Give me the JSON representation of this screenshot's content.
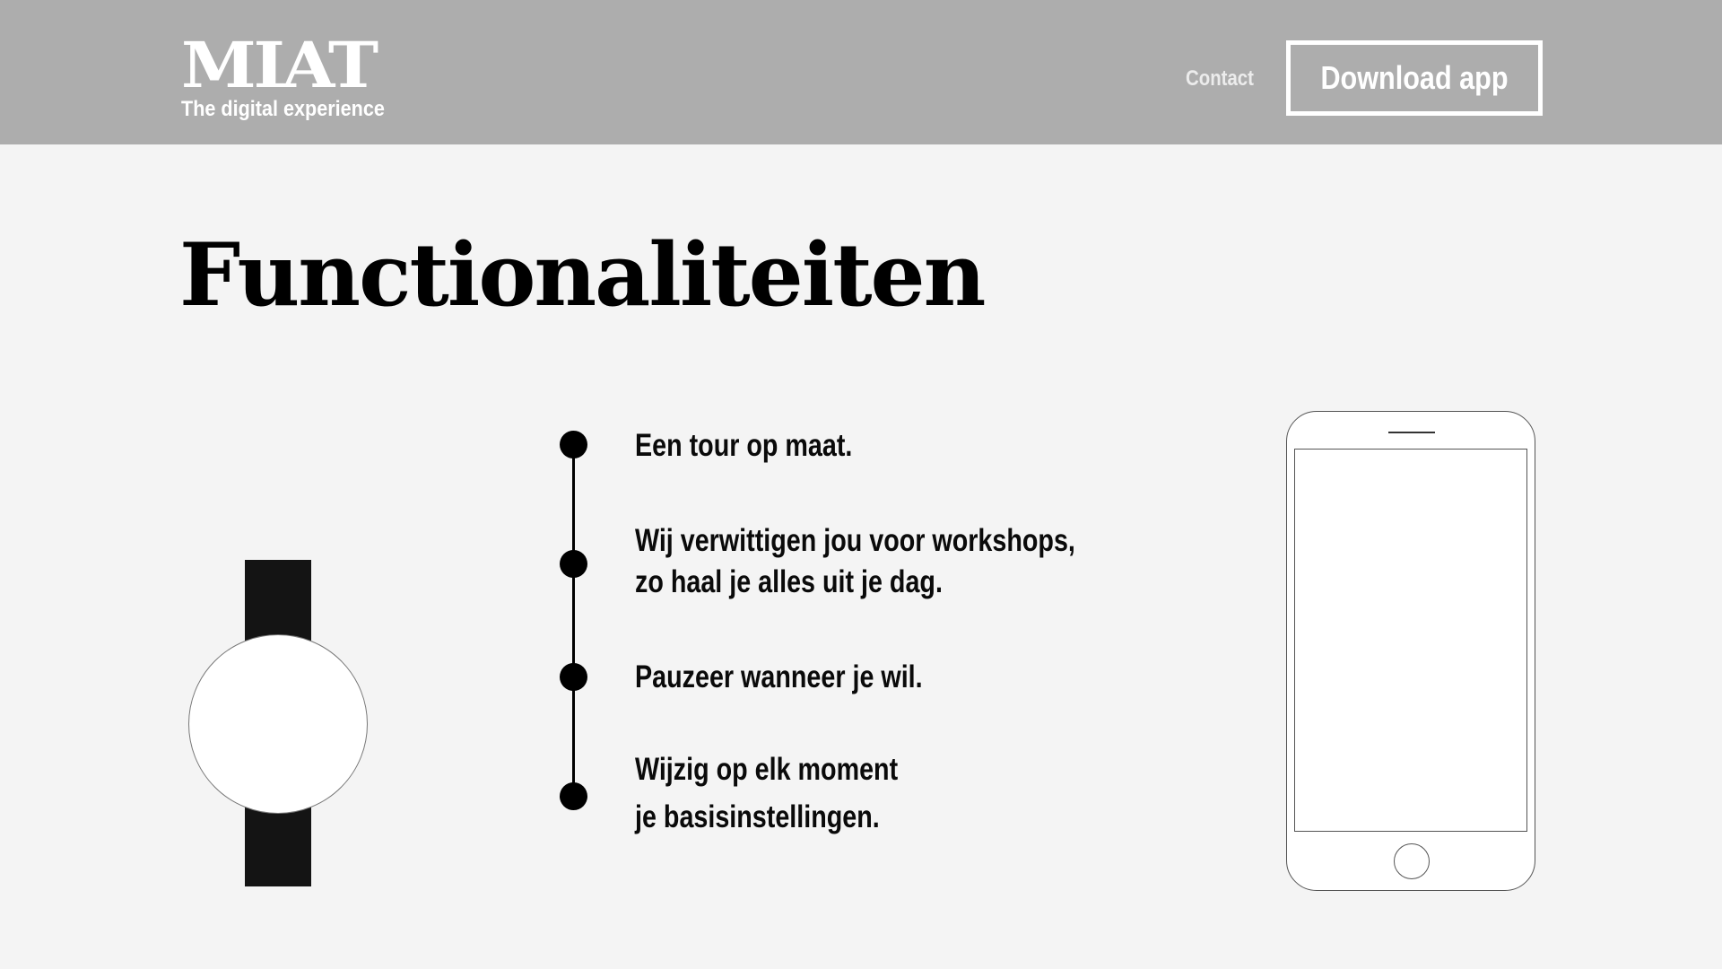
{
  "header": {
    "logo_mark": "MIAT",
    "logo_tagline": "The digital experience",
    "nav_contact": "Contact",
    "download_label": "Download app"
  },
  "main": {
    "title": "Functionaliteiten",
    "features": [
      {
        "text": "Een tour op maat."
      },
      {
        "text": "Wij verwittigen jou voor workshops,\nzo haal je alles uit je dag."
      },
      {
        "text": "Pauzeer wanneer je wil."
      },
      {
        "text": "Wijzig op elk moment\nje basisinstellingen."
      }
    ]
  },
  "colors": {
    "header_bg": "#adadad",
    "page_bg": "#f4f4f4",
    "text": "#000000",
    "header_text": "#ffffff"
  },
  "icons": {
    "watch": "smartwatch-icon",
    "phone": "smartphone-icon"
  }
}
